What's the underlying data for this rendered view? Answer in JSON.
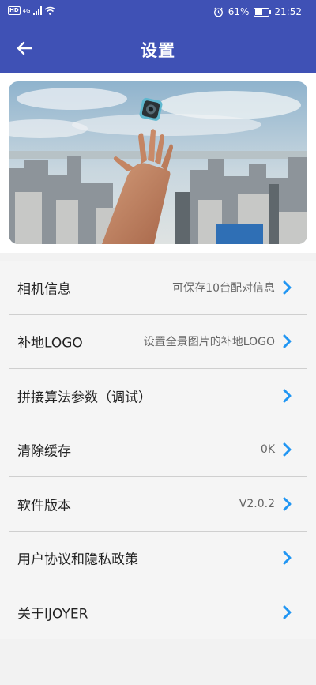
{
  "status_bar": {
    "hd": "HD",
    "network": "4G",
    "battery_percent": "61%",
    "battery_level": 0.61,
    "time": "21:52"
  },
  "header": {
    "title": "设置"
  },
  "colors": {
    "primary": "#3f51b5",
    "chevron": "#2196f3"
  },
  "banner": {
    "image": "city-skyline-hand-camera-photo"
  },
  "settings": [
    {
      "label": "相机信息",
      "value": "可保存10台配对信息"
    },
    {
      "label": "补地LOGO",
      "value": "设置全景图片的补地LOGO"
    },
    {
      "label": "拼接算法参数（调试）",
      "value": ""
    },
    {
      "label": "清除缓存",
      "value": "0K"
    },
    {
      "label": "软件版本",
      "value": "V2.0.2"
    },
    {
      "label": "用户协议和隐私政策",
      "value": ""
    },
    {
      "label": "关于IJOYER",
      "value": ""
    }
  ]
}
